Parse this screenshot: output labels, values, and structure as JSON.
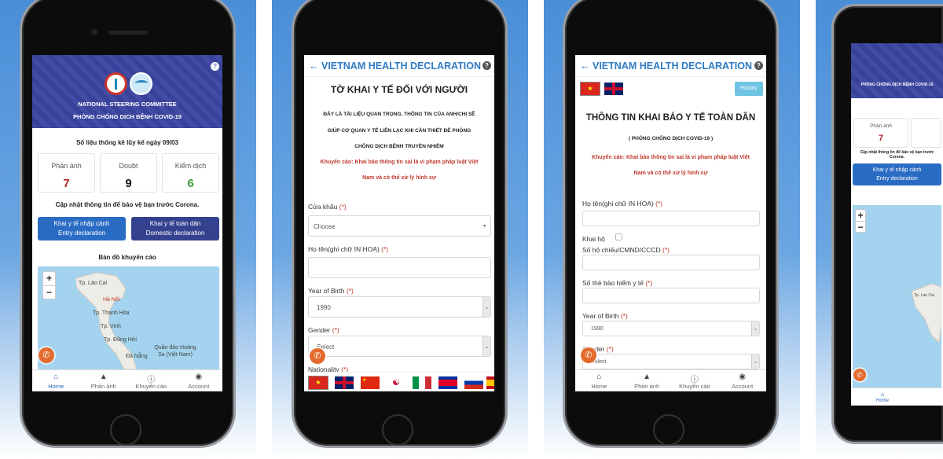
{
  "colors": {
    "header_blue": "#3a45a0",
    "title_blue": "#2f7bc3",
    "entry_button": "#2a6cc4",
    "domestic_button": "#34418f",
    "red_value": "#b0242c",
    "green_value": "#3a9d3a",
    "call_button": "#e46b2d",
    "map_water": "#a3d3ee"
  },
  "home": {
    "help_icon": "question-circle",
    "committee_line1": "NATIONAL STEERING COMMITTEE",
    "committee_line2": "PHÒNG CHỐNG DỊCH BỆNH COVID-19",
    "stats_title": "Số liệu thống kê lũy kế ngày 09/03",
    "stats": [
      {
        "label": "Phản ánh",
        "value": "7"
      },
      {
        "label": "Doubt",
        "value": "9"
      },
      {
        "label": "Kiểm dịch",
        "value": "6"
      }
    ],
    "update_text": "Cập nhật thông tin để bảo vệ bạn trước Corona.",
    "entry_button": {
      "line1": "Khai y tế nhập cảnh",
      "line2": "Entry declaration"
    },
    "domestic_button": {
      "line1": "Khai y tế toàn dân",
      "line2": "Domestic declaration"
    },
    "map_title": "Bản đồ khuyến cáo",
    "map": {
      "zoom_in": "+",
      "zoom_out": "−",
      "labels": [
        "Tp. Lào Cai",
        "Hà Nội",
        "Tp. Thanh Hóa",
        "Tp. Vinh",
        "Tp. Đồng Hới",
        "Quần đảo Hoàng Sa (Việt Nam)",
        "Đà Nẵng"
      ]
    }
  },
  "tabs": [
    {
      "label": "Home",
      "icon": "home"
    },
    {
      "label": "Phản ánh",
      "icon": "warning"
    },
    {
      "label": "Khuyến cáo",
      "icon": "info"
    },
    {
      "label": "Account",
      "icon": "user-circle"
    }
  ],
  "app_title": "VIETNAM HEALTH DECLARATION",
  "entry": {
    "title": "TỜ KHAI Y TẾ ĐỐI VỚI NGƯỜI",
    "notice_lines": [
      "ĐÂY LÀ TÀI LIỆU QUAN TRỌNG, THÔNG TIN CỦA ANH/CHỊ SẼ",
      "GIÚP CƠ QUAN Y TẾ LIÊN LẠC KHI CẦN THIẾT ĐỂ PHÒNG",
      "CHỐNG DỊCH BỆNH TRUYỀN NHIỄM"
    ],
    "warning_lines": [
      "Khuyến cáo: Khai báo thông tin sai là vi phạm pháp luật Việt",
      "Nam và có thể xử lý hình sự"
    ],
    "border_gate_label": "Cửa khẩu",
    "border_gate_value": "Choose",
    "name_label": "Họ tên(ghi chữ IN HOA)",
    "yob_label": "Year of Birth",
    "yob_value": "1990",
    "gender_label": "Gender",
    "gender_value": "Select",
    "nationality_label": "Nationality",
    "required": "(*)",
    "languages": [
      "Vietnamese",
      "English",
      "Chinese",
      "Korean",
      "Italian",
      "Cambodian",
      "Russian",
      "Spanish"
    ]
  },
  "domestic": {
    "history_button": "History",
    "title": "THÔNG TIN KHAI BÁO Y TẾ TOÀN DÂN",
    "subtitle": "( PHÒNG CHỐNG DỊCH COVID-19 )",
    "warning_lines": [
      "Khuyến cáo: Khai báo thông tin sai là vi phạm pháp luật Việt",
      "Nam và có thể xử lý hình sự"
    ],
    "name_label": "Họ tên(ghi chữ IN HOA)",
    "proxy_label": "Khai hộ",
    "proxy_checked": false,
    "id_label": "Số hộ chiếu/CMND/CCCD",
    "insurance_label": "Số thẻ bảo hiểm y tế",
    "yob_label": "Year of Birth",
    "yob_value": "1990",
    "gender_label": "Gender",
    "gender_value": "Select",
    "required": "(*)"
  }
}
